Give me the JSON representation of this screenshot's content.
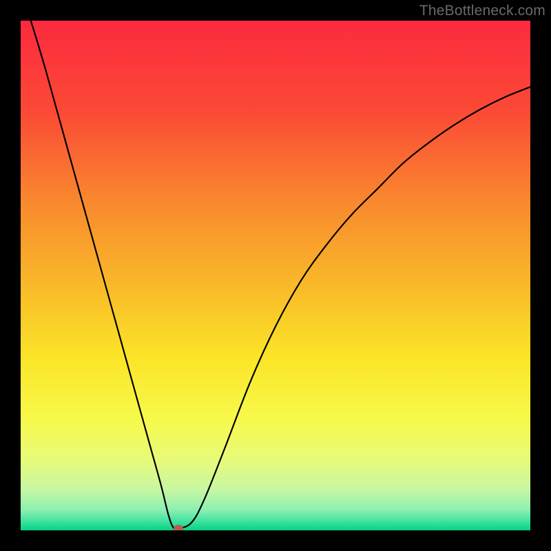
{
  "watermark": "TheBottleneck.com",
  "colors": {
    "black": "#000000",
    "curve": "#000000",
    "marker": "#c05a4a",
    "gradient_stops": [
      {
        "y": 0.0,
        "color": "#fc2a3f"
      },
      {
        "y": 0.18,
        "color": "#fb4a35"
      },
      {
        "y": 0.36,
        "color": "#f98a2e"
      },
      {
        "y": 0.52,
        "color": "#f9b929"
      },
      {
        "y": 0.66,
        "color": "#fbe427"
      },
      {
        "y": 0.78,
        "color": "#f7f94a"
      },
      {
        "y": 0.86,
        "color": "#e8fa78"
      },
      {
        "y": 0.92,
        "color": "#c7f7a2"
      },
      {
        "y": 0.96,
        "color": "#8cefb0"
      },
      {
        "y": 0.985,
        "color": "#36e19d"
      },
      {
        "y": 1.0,
        "color": "#07d182"
      }
    ]
  },
  "chart_data": {
    "type": "line",
    "title": "",
    "xlabel": "",
    "ylabel": "",
    "xlim": [
      0,
      100
    ],
    "ylim": [
      0,
      100
    ],
    "grid": false,
    "legend": false,
    "series": [
      {
        "name": "bottleneck-curve",
        "x": [
          2,
          5,
          10,
          15,
          20,
          25,
          27.5,
          29,
          30,
          31,
          33.5,
          36,
          40,
          45,
          50,
          55,
          60,
          65,
          70,
          75,
          80,
          85,
          90,
          95,
          100
        ],
        "y": [
          100,
          90,
          72,
          54,
          36,
          18,
          9,
          3,
          0.5,
          0.4,
          1.5,
          6,
          16,
          29,
          40,
          49,
          56,
          62,
          67,
          72,
          76,
          79.5,
          82.5,
          85,
          87
        ]
      }
    ],
    "marker": {
      "x": 31,
      "y": 0.4
    }
  }
}
